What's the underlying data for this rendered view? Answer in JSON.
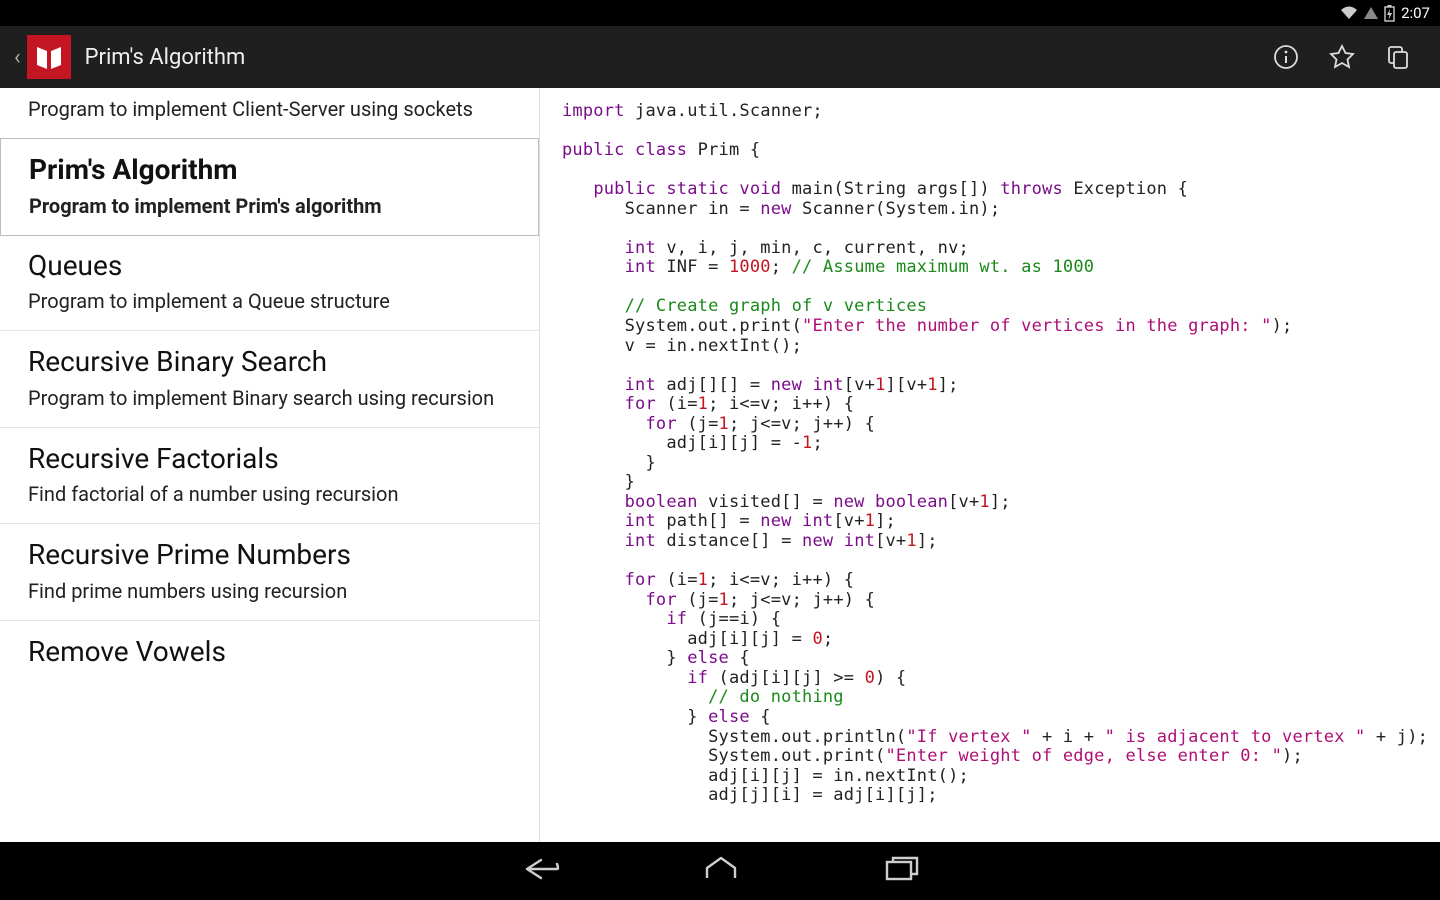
{
  "statusbar": {
    "time": "2:07"
  },
  "actionbar": {
    "title": "Prim's Algorithm",
    "actions": {
      "info": "info",
      "favorite": "favorite",
      "copy": "copy"
    }
  },
  "sidebar": {
    "items": [
      {
        "title": "",
        "sub": "Program to implement Client-Server using sockets",
        "selected": false,
        "partial_top": true
      },
      {
        "title": "Prim's Algorithm",
        "sub": "Program to implement Prim's algorithm",
        "selected": true
      },
      {
        "title": "Queues",
        "sub": "Program to implement a Queue structure",
        "selected": false
      },
      {
        "title": "Recursive Binary Search",
        "sub": "Program to implement Binary search using recursion",
        "selected": false
      },
      {
        "title": "Recursive Factorials",
        "sub": "Find factorial of a number using recursion",
        "selected": false
      },
      {
        "title": "Recursive Prime Numbers",
        "sub": "Find prime numbers using recursion",
        "selected": false
      },
      {
        "title": "Remove Vowels",
        "sub": "",
        "selected": false,
        "partial_bottom": true
      }
    ]
  },
  "code": {
    "tokens": [
      [
        [
          "kw",
          "import"
        ],
        [
          "p",
          " java.util.Scanner;"
        ]
      ],
      [],
      [
        [
          "kw",
          "public class"
        ],
        [
          "p",
          " Prim {"
        ]
      ],
      [],
      [
        [
          "p",
          "   "
        ],
        [
          "kw",
          "public static void"
        ],
        [
          "p",
          " main(String args[]) "
        ],
        [
          "kw",
          "throws"
        ],
        [
          "p",
          " Exception {"
        ]
      ],
      [
        [
          "p",
          "      Scanner in = "
        ],
        [
          "kw",
          "new"
        ],
        [
          "p",
          " Scanner(System.in);"
        ]
      ],
      [],
      [
        [
          "p",
          "      "
        ],
        [
          "kw",
          "int"
        ],
        [
          "p",
          " v, i, j, min, c, current, nv;"
        ]
      ],
      [
        [
          "p",
          "      "
        ],
        [
          "kw",
          "int"
        ],
        [
          "p",
          " INF = "
        ],
        [
          "num",
          "1000"
        ],
        [
          "p",
          "; "
        ],
        [
          "cm",
          "// Assume maximum wt. as 1000"
        ]
      ],
      [],
      [
        [
          "p",
          "      "
        ],
        [
          "cm",
          "// Create graph of v vertices"
        ]
      ],
      [
        [
          "p",
          "      System.out.print("
        ],
        [
          "str",
          "\"Enter the number of vertices in the graph: \""
        ],
        [
          "p",
          ");"
        ]
      ],
      [
        [
          "p",
          "      v = in.nextInt();"
        ]
      ],
      [],
      [
        [
          "p",
          "      "
        ],
        [
          "kw",
          "int"
        ],
        [
          "p",
          " adj[][] = "
        ],
        [
          "kw",
          "new int"
        ],
        [
          "p",
          "[v+"
        ],
        [
          "num",
          "1"
        ],
        [
          "p",
          "][v+"
        ],
        [
          "num",
          "1"
        ],
        [
          "p",
          "];"
        ]
      ],
      [
        [
          "p",
          "      "
        ],
        [
          "kw",
          "for"
        ],
        [
          "p",
          " (i="
        ],
        [
          "num",
          "1"
        ],
        [
          "p",
          "; i<=v; i++) {"
        ]
      ],
      [
        [
          "p",
          "        "
        ],
        [
          "kw",
          "for"
        ],
        [
          "p",
          " (j="
        ],
        [
          "num",
          "1"
        ],
        [
          "p",
          "; j<=v; j++) {"
        ]
      ],
      [
        [
          "p",
          "          adj[i][j] = -"
        ],
        [
          "num",
          "1"
        ],
        [
          "p",
          ";"
        ]
      ],
      [
        [
          "p",
          "        }"
        ]
      ],
      [
        [
          "p",
          "      }"
        ]
      ],
      [
        [
          "p",
          "      "
        ],
        [
          "kw",
          "boolean"
        ],
        [
          "p",
          " visited[] = "
        ],
        [
          "kw",
          "new boolean"
        ],
        [
          "p",
          "[v+"
        ],
        [
          "num",
          "1"
        ],
        [
          "p",
          "];"
        ]
      ],
      [
        [
          "p",
          "      "
        ],
        [
          "kw",
          "int"
        ],
        [
          "p",
          " path[] = "
        ],
        [
          "kw",
          "new int"
        ],
        [
          "p",
          "[v+"
        ],
        [
          "num",
          "1"
        ],
        [
          "p",
          "];"
        ]
      ],
      [
        [
          "p",
          "      "
        ],
        [
          "kw",
          "int"
        ],
        [
          "p",
          " distance[] = "
        ],
        [
          "kw",
          "new int"
        ],
        [
          "p",
          "[v+"
        ],
        [
          "num",
          "1"
        ],
        [
          "p",
          "];"
        ]
      ],
      [],
      [
        [
          "p",
          "      "
        ],
        [
          "kw",
          "for"
        ],
        [
          "p",
          " (i="
        ],
        [
          "num",
          "1"
        ],
        [
          "p",
          "; i<=v; i++) {"
        ]
      ],
      [
        [
          "p",
          "        "
        ],
        [
          "kw",
          "for"
        ],
        [
          "p",
          " (j="
        ],
        [
          "num",
          "1"
        ],
        [
          "p",
          "; j<=v; j++) {"
        ]
      ],
      [
        [
          "p",
          "          "
        ],
        [
          "kw",
          "if"
        ],
        [
          "p",
          " (j==i) {"
        ]
      ],
      [
        [
          "p",
          "            adj[i][j] = "
        ],
        [
          "num",
          "0"
        ],
        [
          "p",
          ";"
        ]
      ],
      [
        [
          "p",
          "          } "
        ],
        [
          "kw",
          "else"
        ],
        [
          "p",
          " {"
        ]
      ],
      [
        [
          "p",
          "            "
        ],
        [
          "kw",
          "if"
        ],
        [
          "p",
          " (adj[i][j] >= "
        ],
        [
          "num",
          "0"
        ],
        [
          "p",
          ") {"
        ]
      ],
      [
        [
          "p",
          "              "
        ],
        [
          "cm",
          "// do nothing"
        ]
      ],
      [
        [
          "p",
          "            } "
        ],
        [
          "kw",
          "else"
        ],
        [
          "p",
          " {"
        ]
      ],
      [
        [
          "p",
          "              System.out.println("
        ],
        [
          "str",
          "\"If vertex \""
        ],
        [
          "p",
          " + i + "
        ],
        [
          "str",
          "\" is adjacent to vertex \""
        ],
        [
          "p",
          " + j);"
        ]
      ],
      [
        [
          "p",
          "              System.out.print("
        ],
        [
          "str",
          "\"Enter weight of edge, else enter 0: \""
        ],
        [
          "p",
          ");"
        ]
      ],
      [
        [
          "p",
          "              adj[i][j] = in.nextInt();"
        ]
      ],
      [
        [
          "p",
          "              adj[j][i] = adj[i][j];"
        ]
      ]
    ]
  }
}
